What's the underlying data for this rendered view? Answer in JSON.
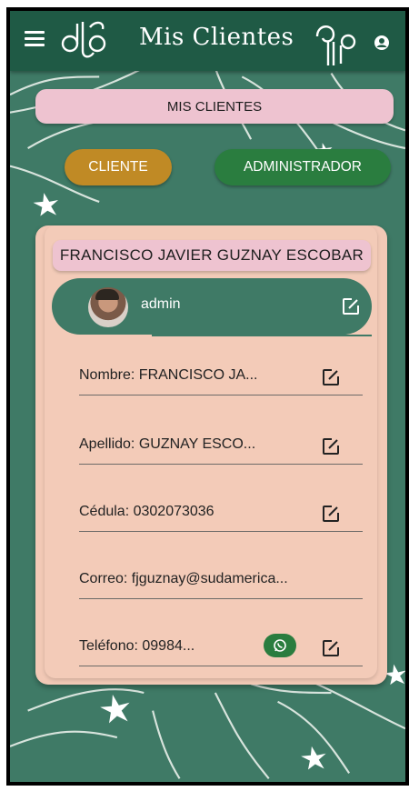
{
  "header": {
    "title": "Mis Clientes",
    "icons": [
      "menu-icon",
      "ornament-logo-left",
      "ornament-logo-right",
      "account-circle-icon"
    ],
    "bar_color": "#1f5a45"
  },
  "banner": {
    "label": "MIS CLIENTES"
  },
  "role_buttons": {
    "cliente": "CLIENTE",
    "administrador": "ADMINISTRADOR",
    "cliente_color": "#c08a25",
    "administrador_color": "#2a7d3f"
  },
  "client_card": {
    "full_name": "FRANCISCO JAVIER GUZNAY ESCOBAR",
    "username": "admin",
    "fields": {
      "nombre": "Nombre: FRANCISCO JA...",
      "apellido": "Apellido: GUZNAY ESCO...",
      "cedula": "Cédula: 0302073036",
      "correo": "Correo: fjguznay@sudamerica...",
      "telefono": "Teléfono: 09984..."
    }
  },
  "colors": {
    "background": "#3f7a66",
    "card": "#f2c9b6",
    "chip": "#eec3d0"
  }
}
